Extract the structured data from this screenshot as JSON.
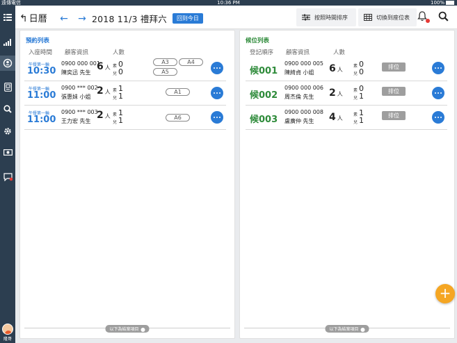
{
  "status_bar": {
    "carrier": "遠傳電信",
    "time": "10:36 PM",
    "battery": "100%"
  },
  "side_nav": {
    "items": [
      {
        "icon": "grid-icon"
      },
      {
        "icon": "bar-chart-icon"
      },
      {
        "icon": "refresh-person-icon"
      },
      {
        "icon": "receipt-icon"
      },
      {
        "icon": "search-icon"
      },
      {
        "icon": "gear-icon"
      },
      {
        "icon": "cash-icon"
      },
      {
        "icon": "chat-icon"
      }
    ],
    "user_name": "隆哥"
  },
  "header": {
    "back_label": "日曆",
    "date_label": "2018 11/3 禮拜六",
    "today_button": "回到今日",
    "sort_button": "按照時間排序",
    "switch_button": "切換到座位表"
  },
  "reservations": {
    "title": "預約列表",
    "columns": [
      "入座時間",
      "顧客資訊",
      "人數"
    ],
    "rows": [
      {
        "meal": "午餐第一輪",
        "time": "10:30",
        "phone": "0900 000 001",
        "name": "陳奕迅 先生",
        "people": "6",
        "people_unit": "人",
        "veg_label": "素",
        "veg": "0",
        "kid_label": "兒",
        "kids": "0",
        "tables": [
          "A3",
          "A4",
          "A5"
        ]
      },
      {
        "meal": "午餐第一輪",
        "time": "11:00",
        "phone": "0900 *** 002",
        "name": "張惠妹 小姐",
        "people": "2",
        "people_unit": "人",
        "veg_label": "素",
        "veg": "1",
        "kid_label": "兒",
        "kids": "1",
        "tables": [
          "A1"
        ]
      },
      {
        "meal": "午餐第一輪",
        "time": "11:00",
        "phone": "0900 *** 003",
        "name": "王力宏 先生",
        "people": "2",
        "people_unit": "人",
        "veg_label": "素",
        "veg": "1",
        "kid_label": "兒",
        "kids": "1",
        "tables": [
          "A6"
        ]
      }
    ],
    "footer": "以下為結案項目"
  },
  "waitlist": {
    "title": "候位列表",
    "columns": [
      "登記順序",
      "顧客資訊",
      "人數"
    ],
    "rows": [
      {
        "code": "候001",
        "phone": "0900 000 005",
        "name": "陳綺貞 小姐",
        "people": "6",
        "people_unit": "人",
        "veg_label": "素",
        "veg": "0",
        "kid_label": "兒",
        "kids": "0",
        "action": "排位"
      },
      {
        "code": "候002",
        "phone": "0900 000 006",
        "name": "周杰倫 先生",
        "people": "2",
        "people_unit": "人",
        "veg_label": "素",
        "veg": "0",
        "kid_label": "兒",
        "kids": "1",
        "action": "排位"
      },
      {
        "code": "候003",
        "phone": "0900 000 008",
        "name": "盧廣仲 先生",
        "people": "4",
        "people_unit": "人",
        "veg_label": "素",
        "veg": "1",
        "kid_label": "兒",
        "kids": "1",
        "action": "排位"
      }
    ],
    "footer": "以下為結案項目"
  },
  "fab_label": "+",
  "colors": {
    "accent_blue": "#2a7bd6",
    "accent_green": "#2e8b3a",
    "nav_bg": "#2c3e50",
    "fab": "#f5a623"
  }
}
